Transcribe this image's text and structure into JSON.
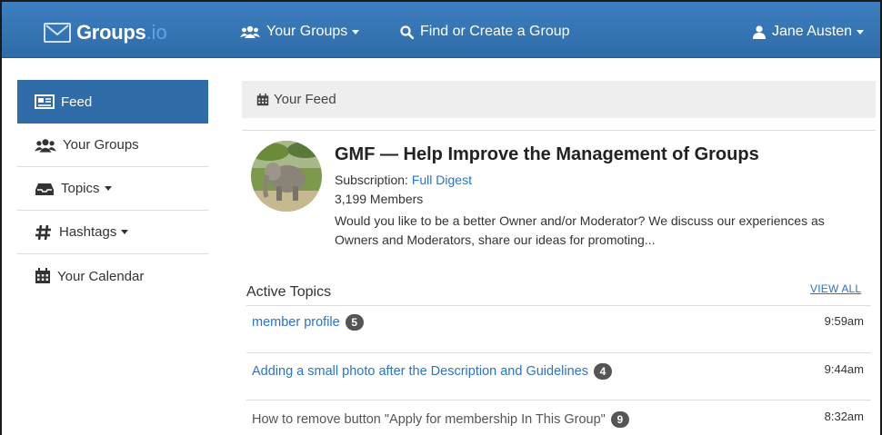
{
  "navbar": {
    "brand_name": "Groups",
    "brand_tld": ".io",
    "your_groups": "Your Groups",
    "find_group": "Find or Create a Group",
    "user_name": "Jane Austen"
  },
  "sidebar": {
    "items": [
      {
        "label": "Feed",
        "icon": "newspaper-icon"
      },
      {
        "label": "Your Groups",
        "icon": "users-icon"
      },
      {
        "label": "Topics",
        "icon": "inbox-icon"
      },
      {
        "label": "Hashtags",
        "icon": "hashtag-icon"
      },
      {
        "label": "Your Calendar",
        "icon": "calendar-icon"
      }
    ]
  },
  "feed": {
    "header": "Your Feed",
    "group": {
      "title": "GMF — Help Improve the Management of Groups",
      "subscription_label": "Subscription:",
      "subscription_value": "Full Digest",
      "members": "3,199 Members",
      "description": "Would you like to be a better Owner and/or Moderator? We discuss our experiences as Owners and Moderators, share our ideas for promoting..."
    },
    "active_topics_label": "Active Topics",
    "view_all": "VIEW ALL",
    "topics": [
      {
        "title": "member profile",
        "count": "5",
        "time": "9:59am"
      },
      {
        "title": "Adding a small photo after the Description and Guidelines",
        "count": "4",
        "time": "9:44am"
      },
      {
        "title": "How to remove button \"Apply for membership In This Group\"",
        "count": "9",
        "time": "8:32am"
      }
    ]
  },
  "colors": {
    "navbar": "#3573b3",
    "active": "#2f6ca8",
    "link": "#2a73c7"
  }
}
